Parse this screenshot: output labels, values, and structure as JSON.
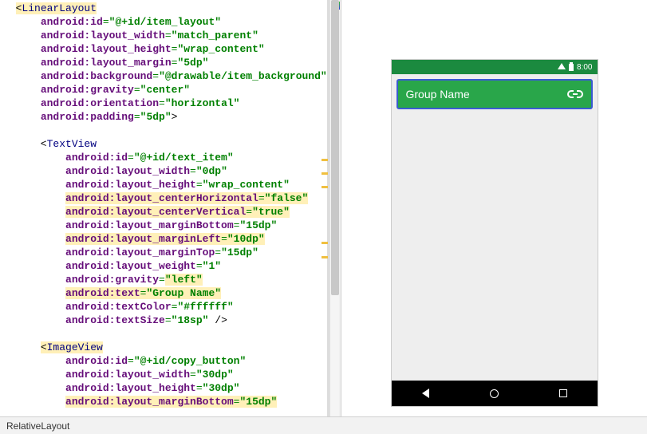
{
  "code": {
    "lines": [
      {
        "pre": "  ",
        "open": "<",
        "tag": "LinearLayout",
        "hl_tag": true
      },
      {
        "pre": "      ",
        "attr": "android:id",
        "val": "\"@+id/item_layout\""
      },
      {
        "pre": "      ",
        "attr": "android:layout_width",
        "val": "\"match_parent\""
      },
      {
        "pre": "      ",
        "attr": "android:layout_height",
        "val": "\"wrap_content\""
      },
      {
        "pre": "      ",
        "attr": "android:layout_margin",
        "val": "\"5dp\""
      },
      {
        "pre": "      ",
        "attr": "android:background",
        "val": "\"@drawable/item_background\""
      },
      {
        "pre": "      ",
        "attr": "android:gravity",
        "val": "\"center\""
      },
      {
        "pre": "      ",
        "attr": "android:orientation",
        "val": "\"horizontal\""
      },
      {
        "pre": "      ",
        "attr": "android:padding",
        "val": "\"5dp\"",
        "tail": ">"
      },
      {
        "pre": ""
      },
      {
        "pre": "      ",
        "open": "<",
        "tag": "TextView"
      },
      {
        "pre": "          ",
        "attr": "android:id",
        "val": "\"@+id/text_item\""
      },
      {
        "pre": "          ",
        "attr": "android:layout_width",
        "val": "\"0dp\""
      },
      {
        "pre": "          ",
        "attr": "android:layout_height",
        "val": "\"wrap_content\""
      },
      {
        "pre": "          ",
        "attr": "android:layout_centerHorizontal",
        "val": "\"false\"",
        "hl_line": true
      },
      {
        "pre": "          ",
        "attr": "android:layout_centerVertical",
        "val": "\"true\"",
        "hl_line": true
      },
      {
        "pre": "          ",
        "attr": "android:layout_marginBottom",
        "val": "\"15dp\""
      },
      {
        "pre": "          ",
        "attr": "android:layout_marginLeft",
        "val": "\"10dp\"",
        "hl_line": true
      },
      {
        "pre": "          ",
        "attr": "android:layout_marginTop",
        "val": "\"15dp\""
      },
      {
        "pre": "          ",
        "attr": "android:layout_weight",
        "val": "\"1\""
      },
      {
        "pre": "          ",
        "attr": "android:gravity",
        "val": "\"left\"",
        "hl_val": true
      },
      {
        "pre": "          ",
        "attr": "android:text",
        "val": "\"Group Name\"",
        "hl_line": true
      },
      {
        "pre": "          ",
        "attr": "android:textColor",
        "val": "\"#ffffff\""
      },
      {
        "pre": "          ",
        "attr": "android:textSize",
        "val": "\"18sp\"",
        "tail": " />"
      },
      {
        "pre": ""
      },
      {
        "pre": "      ",
        "open": "<",
        "tag": "ImageView",
        "hl_tag": true
      },
      {
        "pre": "          ",
        "attr": "android:id",
        "val": "\"@+id/copy_button\""
      },
      {
        "pre": "          ",
        "attr": "android:layout_width",
        "val": "\"30dp\""
      },
      {
        "pre": "          ",
        "attr": "android:layout_height",
        "val": "\"30dp\""
      },
      {
        "pre": "          ",
        "attr": "android:layout_marginBottom",
        "val": "\"15dp\"",
        "hl_line": true,
        "cut": true
      }
    ]
  },
  "gutter_marks": [
    199,
    216,
    233,
    303,
    321
  ],
  "preview": {
    "time": "8:00",
    "card_text": "Group Name"
  },
  "status": "RelativeLayout"
}
